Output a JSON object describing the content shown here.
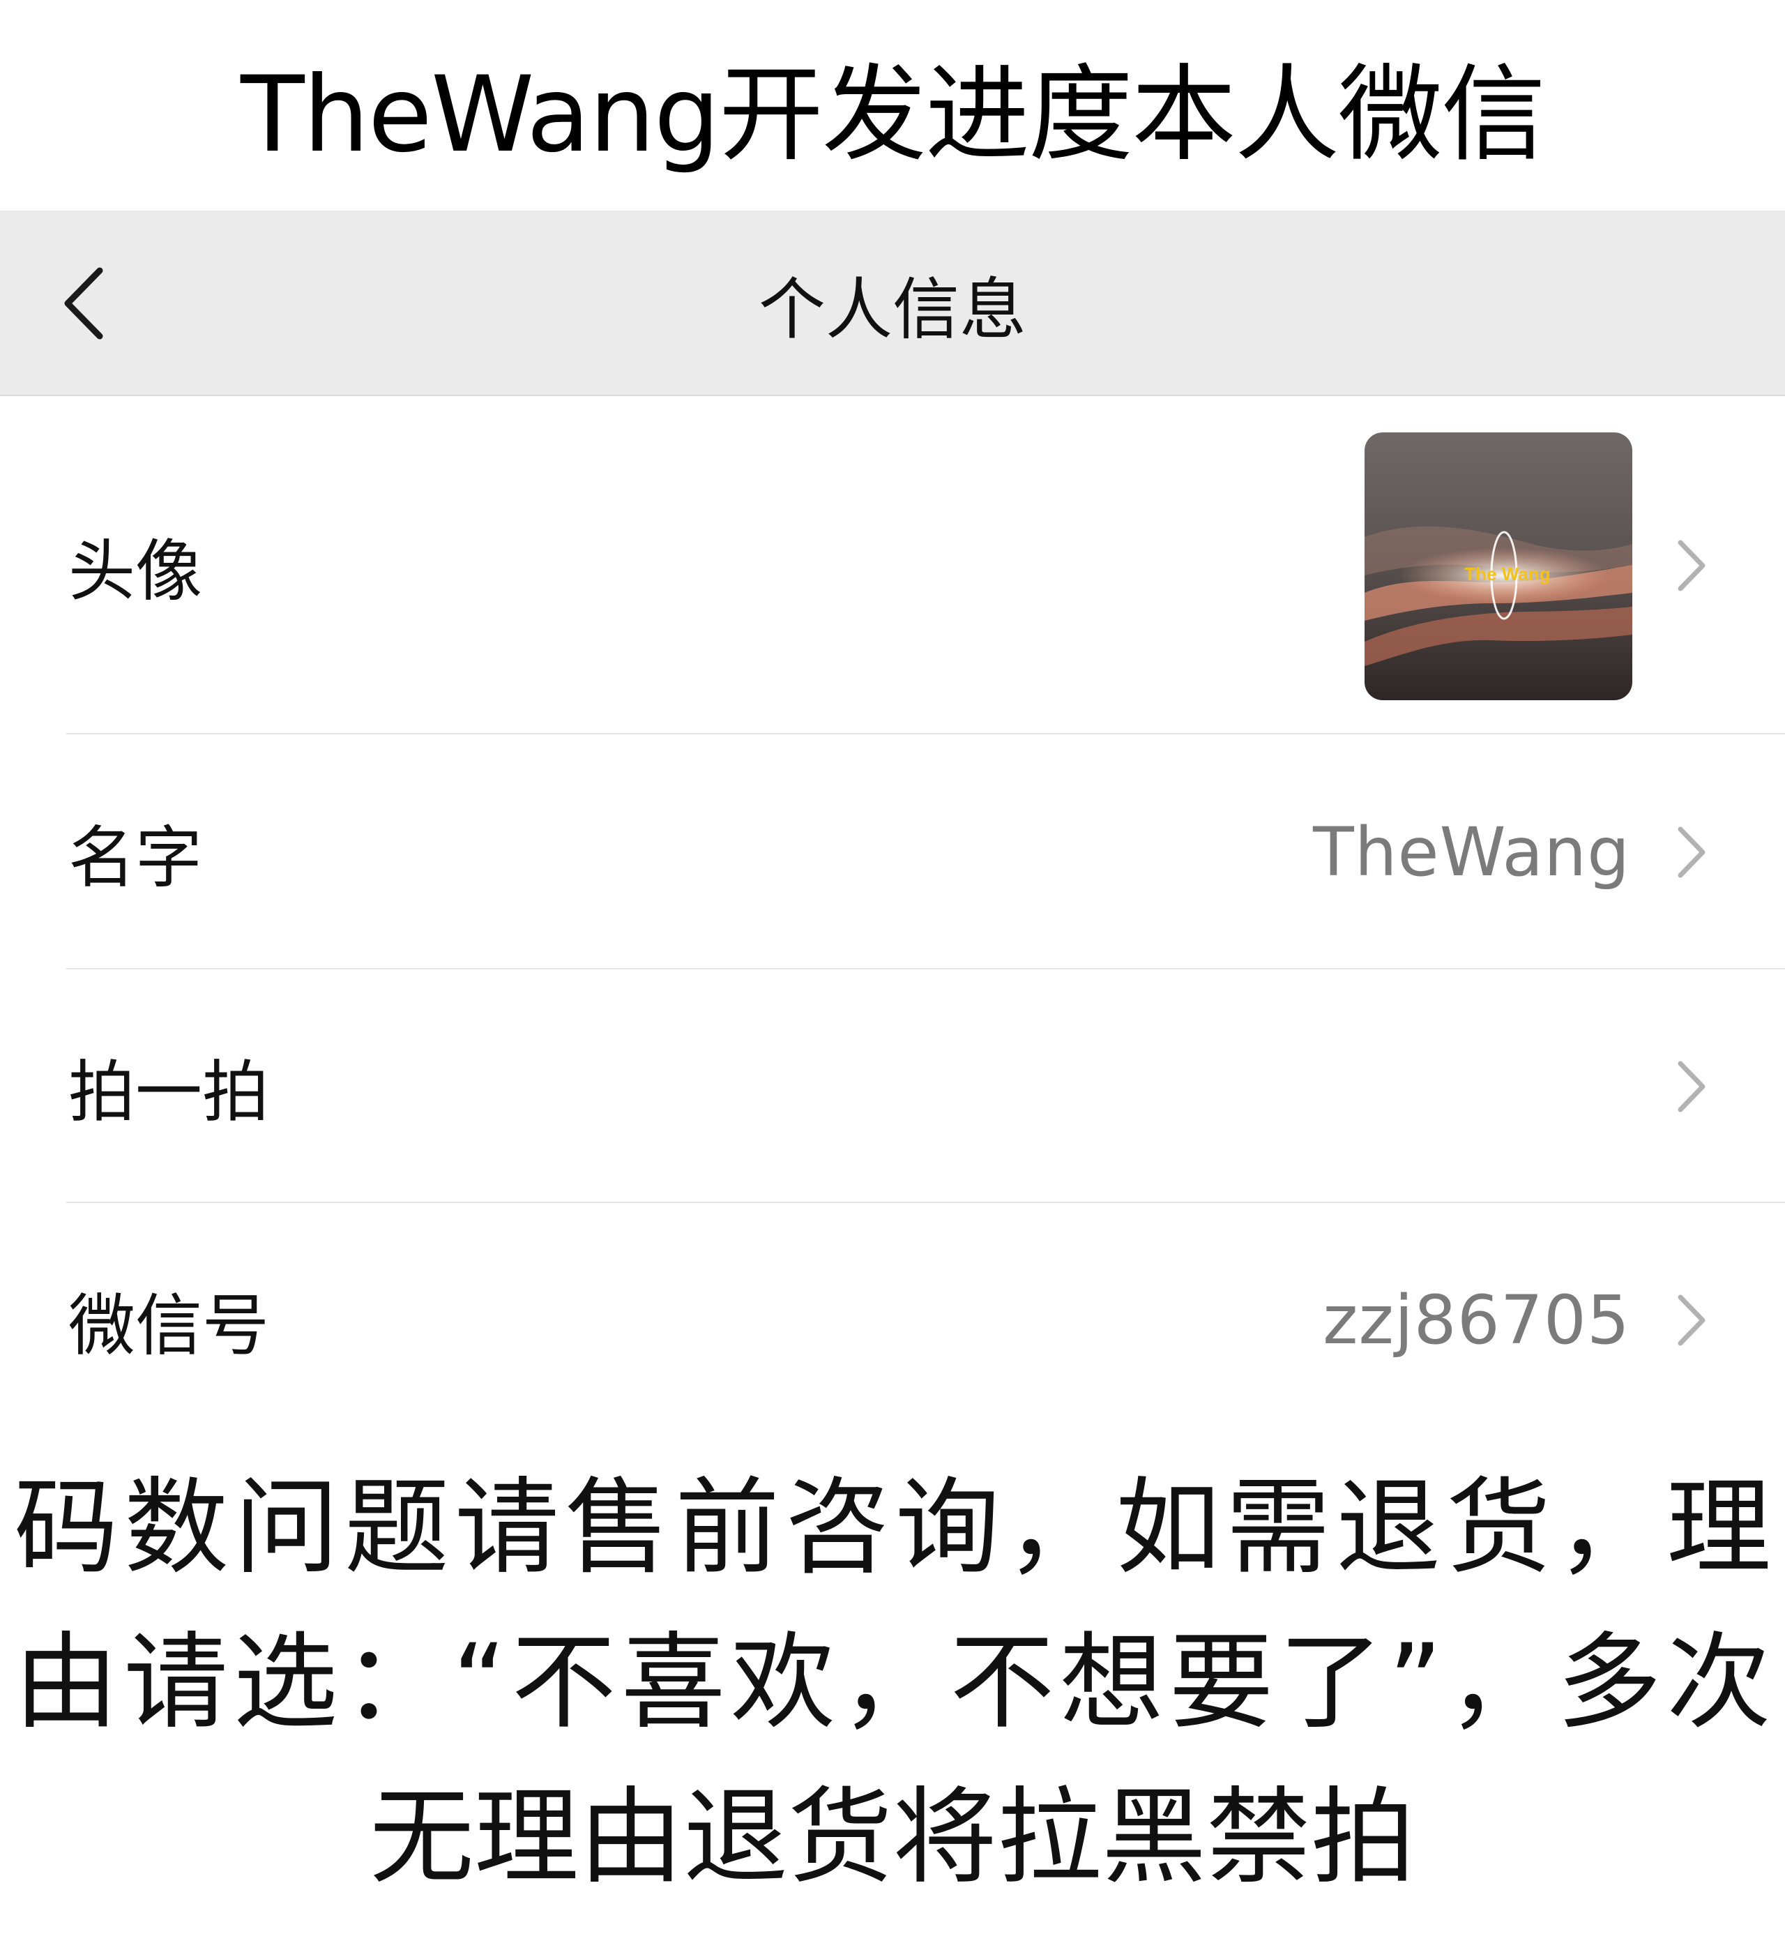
{
  "caption": {
    "title": "TheWang开发进度本人微信"
  },
  "navbar": {
    "back_icon": "chevron-left-icon",
    "title": "个人信息"
  },
  "profile": {
    "rows": [
      {
        "label": "头像",
        "value": "",
        "avatar_text": "The Wang",
        "icon": "chevron-right-icon"
      },
      {
        "label": "名字",
        "value": "TheWang",
        "icon": "chevron-right-icon"
      },
      {
        "label": "拍一拍",
        "value": "",
        "icon": "chevron-right-icon"
      },
      {
        "label": "微信号",
        "value": "zzj86705",
        "icon": "chevron-right-icon"
      }
    ]
  },
  "notice": {
    "text": "码数问题请售前咨询，如需退货，理由请选：“不喜欢，不想要了”，多次无理由退货将拉黑禁拍"
  },
  "colors": {
    "navbar_bg": "#ebebeb",
    "value_text": "#7b7b7b",
    "chevron": "#b2b2b2",
    "divider": "#e4e4e4"
  }
}
